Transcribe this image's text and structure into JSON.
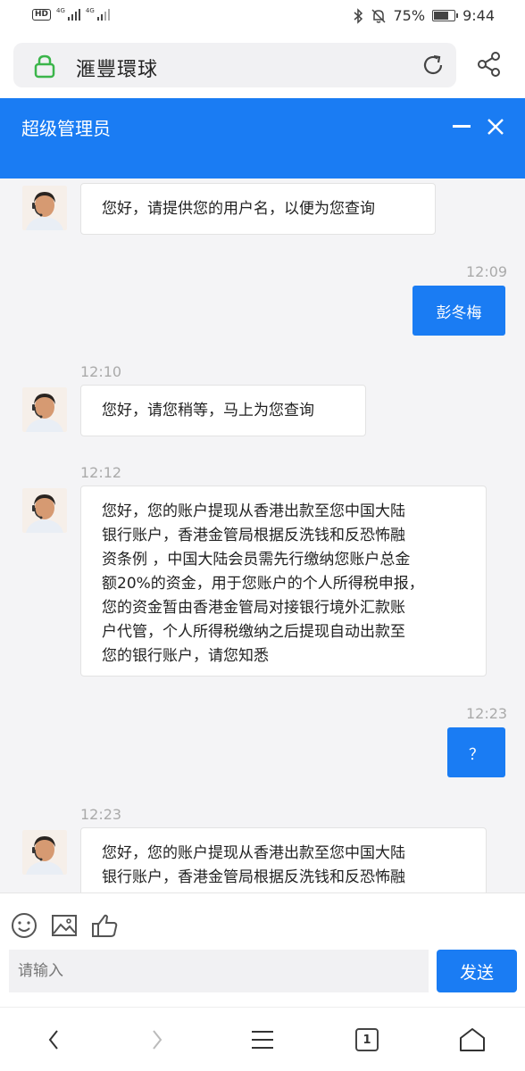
{
  "status_bar": {
    "hd_label": "HD",
    "network_1": "4G",
    "network_2": "4G",
    "battery": "75%",
    "battery_level": 0.75,
    "time": "9:44"
  },
  "browser": {
    "url_title": "滙豐環球"
  },
  "chat": {
    "header_title": "超级管理员",
    "messages": [
      {
        "from": "agent",
        "text": "您好，请提供您的用户名，以便为您查询"
      },
      {
        "from": "user",
        "time": "12:09",
        "text": "彭冬梅"
      },
      {
        "from": "agent",
        "time": "12:10",
        "text": "您好，请您稍等，马上为您查询"
      },
      {
        "from": "agent",
        "time": "12:12",
        "lines": [
          "您好，您的账户提现从香港出款至您中国大陆",
          "银行账户，香港金管局根据反洗钱和反恐怖融",
          "资条例 ，中国大陆会员需先行缴纳您账户总金",
          "额20%的资金，用于您账户的个人所得税申报，",
          "您的资金暂由香港金管局对接银行境外汇款账",
          "户代管，个人所得税缴纳之后提现自动出款至",
          "您的银行账户，请您知悉"
        ]
      },
      {
        "from": "user",
        "time": "12:23",
        "text": "？"
      },
      {
        "from": "agent",
        "time": "12:23",
        "lines": [
          "您好，您的账户提现从香港出款至您中国大陆",
          "银行账户，香港金管局根据反洗钱和反恐怖融"
        ]
      }
    ]
  },
  "composer": {
    "placeholder": "请输入",
    "send_label": "发送"
  },
  "nav": {
    "tab_count": "1"
  },
  "colors": {
    "accent": "#1a7cf3",
    "chat_bg": "#f4f4f6"
  }
}
